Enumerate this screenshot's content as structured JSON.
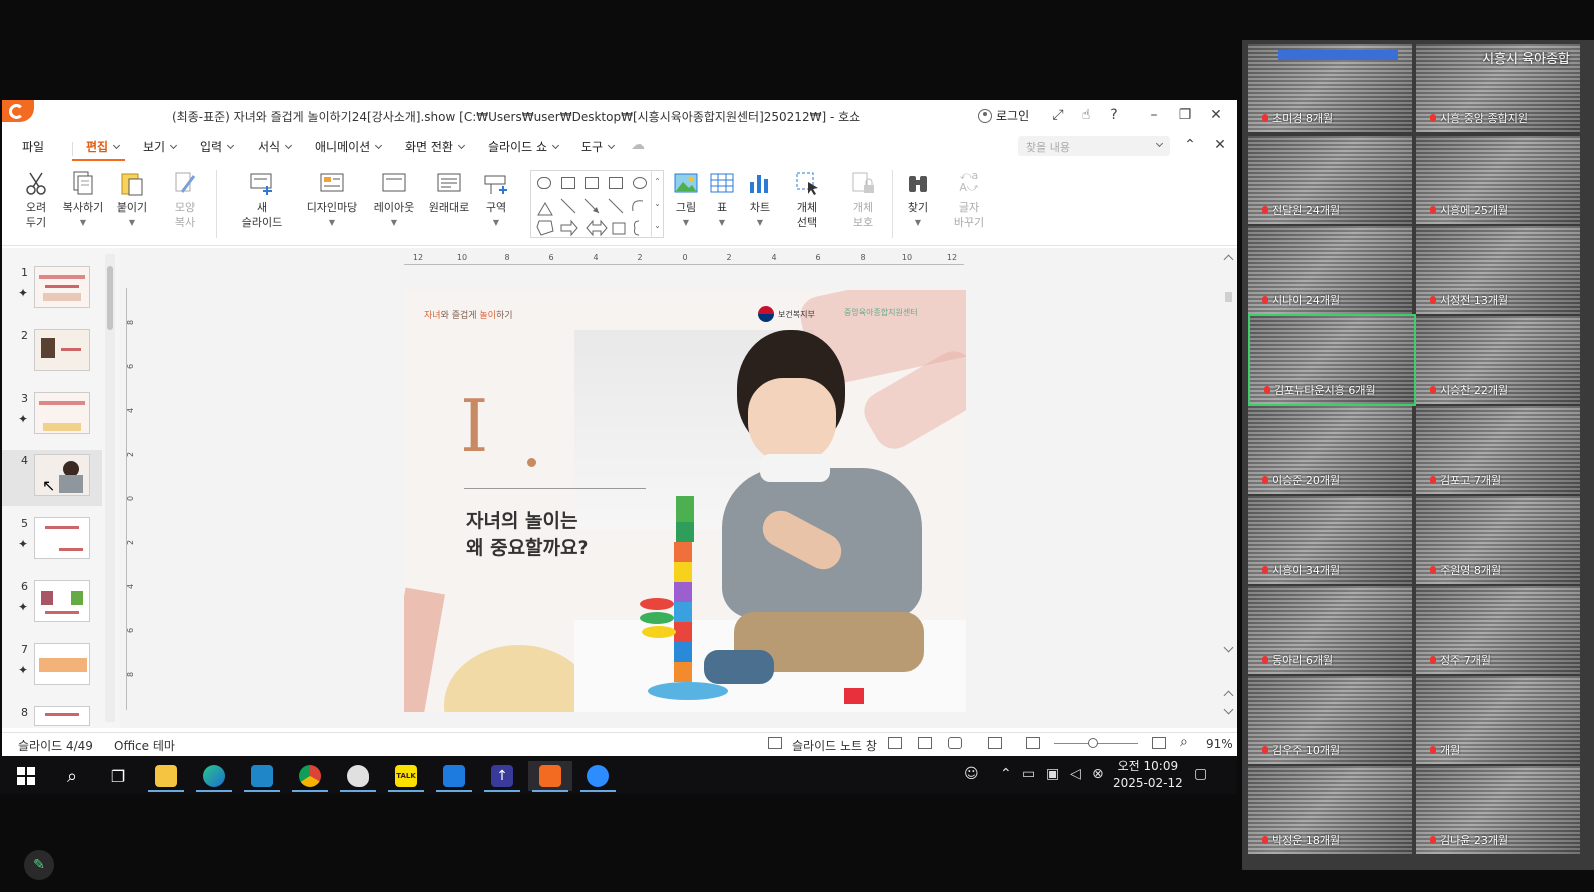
{
  "window": {
    "title": "(최종-표준) 자녀와 즐겁게 놀이하기24[강사소개].show [C:₩Users₩user₩Desktop₩[시흥시육아종합지원센터]250212₩] - 호쇼",
    "login_label": "로그인",
    "icons": [
      "restore-fullscreen-icon",
      "hand-icon",
      "help-icon",
      "minimize-icon",
      "maximize-icon",
      "close-icon"
    ]
  },
  "menu": {
    "file": "파일",
    "items": [
      "편집",
      "보기",
      "입력",
      "서식",
      "애니메이션",
      "화면 전환",
      "슬라이드 쇼",
      "도구"
    ],
    "active": "편집",
    "search_placeholder": "찾을 내용"
  },
  "ribbon": {
    "cut": [
      "오려",
      "두기"
    ],
    "copy": "복사하기",
    "paste": "붙이기",
    "format_painter": [
      "모양",
      "복사"
    ],
    "new_slide": [
      "새",
      "슬라이드"
    ],
    "design": "디자인마당",
    "layout": "레이아웃",
    "reset": "원래대로",
    "section": "구역",
    "picture": "그림",
    "table": "표",
    "chart": "차트",
    "select_object": [
      "개체",
      "선택"
    ],
    "protect_object": [
      "개체",
      "보호"
    ],
    "find": "찾기",
    "replace_font": [
      "글자",
      "바꾸기"
    ]
  },
  "thumbnails": [
    {
      "num": "1"
    },
    {
      "num": "2"
    },
    {
      "num": "3"
    },
    {
      "num": "4"
    },
    {
      "num": "5"
    },
    {
      "num": "6"
    },
    {
      "num": "7"
    },
    {
      "num": "8"
    }
  ],
  "ruler": {
    "h": [
      "12",
      "10",
      "8",
      "6",
      "4",
      "2",
      "0",
      "2",
      "4",
      "6",
      "8",
      "10",
      "12"
    ],
    "v": [
      "8",
      "6",
      "4",
      "2",
      "0",
      "2",
      "4",
      "6",
      "8"
    ]
  },
  "slide": {
    "header_prefix": "자녀",
    "header_mid": "와 즐겁게 ",
    "header_suffix": "놀이",
    "header_end": "하기",
    "logo1": "보건복지부",
    "logo2": "중앙육아종합지원센터",
    "numeral": "I",
    "heading": "자녀의 놀이는\n왜 중요할까요?"
  },
  "status": {
    "slide_counter": "슬라이드 4/49",
    "theme": "Office 테마",
    "notes": "슬라이드 노트 창",
    "zoom": "91%"
  },
  "taskbar": {
    "apps": [
      "start-icon",
      "search-icon",
      "task-view-icon",
      "file-explorer-icon",
      "edge-icon",
      "app-store-icon",
      "chrome-icon",
      "paint-icon",
      "kakaotalk-icon",
      "media-player-icon",
      "upload-app-icon",
      "hancom-show-icon",
      "zoom-icon"
    ],
    "clock_time": "오전 10:09",
    "clock_date": "2025-02-12"
  },
  "gallery": {
    "title": "시흥시 육아종합",
    "tiles": [
      "초미경 8개월",
      "시흥 중앙 종합지원",
      "전달원 24개월",
      "시흥에 25개월",
      "시나이 24개월",
      "서정전 13개월",
      "김포뉴타운시흥 6개월",
      "시승찬 22개월",
      "이승준 20개월",
      "김포고 7개월",
      "시흥이 34개월",
      "주원영 8개월",
      "동아리 6개월",
      "정주 7개월",
      "김우주 10개월",
      "개월",
      "박정운 18개월",
      "김나윤 23개월"
    ]
  },
  "colors": {
    "accent": "#f26b21",
    "slide_numeral": "#c88a62",
    "zoom_highlight": "#3ccf6a"
  }
}
